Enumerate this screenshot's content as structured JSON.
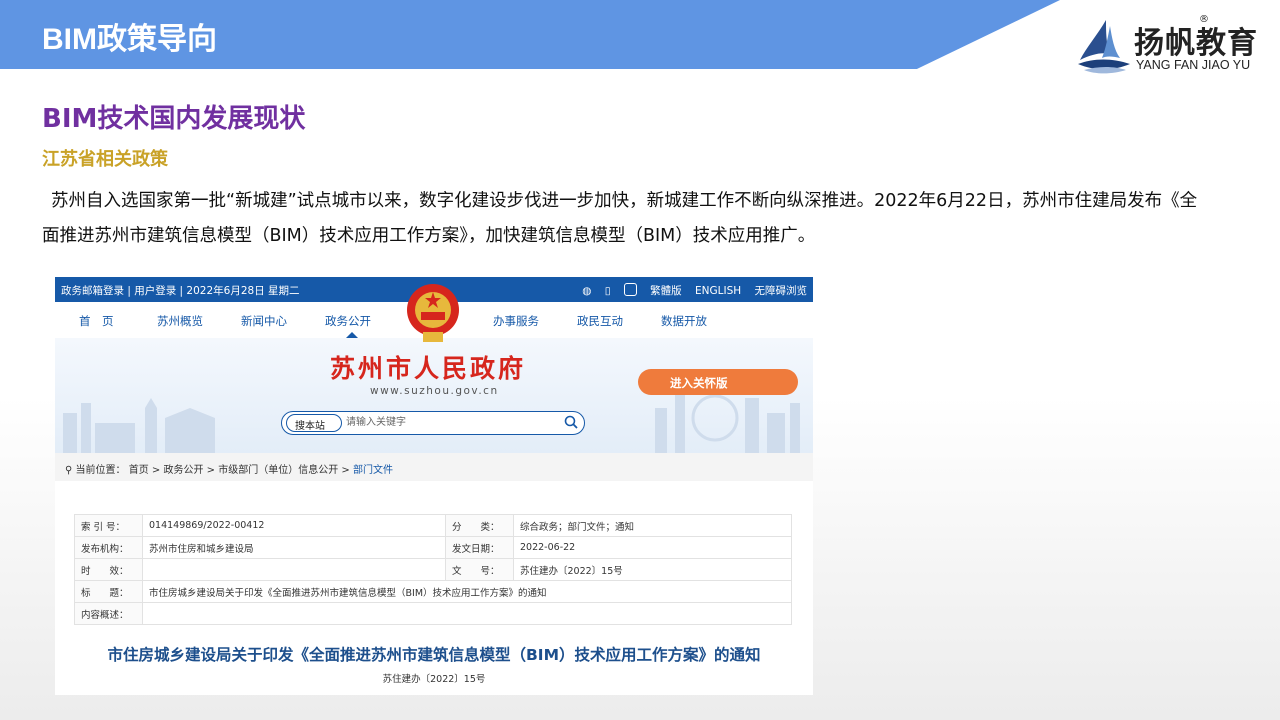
{
  "header": {
    "title": "BIM政策导向"
  },
  "logo": {
    "cn": "扬帆教育",
    "en": "YANG FAN JIAO YU",
    "reg": "®"
  },
  "section": {
    "title": "BIM技术国内发展现状",
    "subtitle": "江苏省相关政策"
  },
  "body_text": "苏州自入选国家第一批“新城建”试点城市以来，数字化建设步伐进一步加快，新城建工作不断向纵深推进。2022年6月22日，苏州市住建局发布《全面推进苏州市建筑信息模型（BIM）技术应用工作方案》，加快建筑信息模型（BIM）技术应用推广。",
  "colors": {
    "banner": "#5f95e3",
    "section_title": "#7030a0",
    "subtitle": "#c9a227",
    "site_blue": "#1659a8",
    "site_red": "#d6261d",
    "care_orange": "#ef7b3c"
  },
  "website": {
    "topbar": {
      "left": "政务邮箱登录 | 用户登录 | 2022年6月28日 星期二",
      "right_links": [
        "繁體版",
        "ENGLISH",
        "无障碍浏览"
      ],
      "icons": [
        "wechat-icon",
        "mobile-icon",
        "robot-icon"
      ]
    },
    "nav": [
      "首　页",
      "苏州概览",
      "新闻中心",
      "政务公开",
      "办事服务",
      "政民互动",
      "数据开放"
    ],
    "site_title": "苏州市人民政府",
    "site_url": "www.suzhou.gov.cn",
    "care_button": "进入关怀版",
    "search": {
      "scope": "搜本站",
      "placeholder": "请输入关键字"
    },
    "breadcrumb": {
      "label": "当前位置：",
      "items": [
        "首页",
        "政务公开",
        "市级部门（单位）信息公开",
        "部门文件"
      ],
      "sep": " > "
    },
    "doc_meta": [
      {
        "k1": "索 引 号：",
        "v1": "014149869/2022-00412",
        "k2": "分　　类：",
        "v2": "综合政务；部门文件；通知"
      },
      {
        "k1": "发布机构：",
        "v1": "苏州市住房和城乡建设局",
        "k2": "发文日期：",
        "v2": "2022-06-22"
      },
      {
        "k1": "时　　效：",
        "v1": "",
        "k2": "文　　号：",
        "v2": "苏住建办〔2022〕15号"
      }
    ],
    "doc_meta_title": {
      "k": "标　　题：",
      "v": "市住房城乡建设局关于印发《全面推进苏州市建筑信息模型（BIM）技术应用工作方案》的通知"
    },
    "doc_meta_summary": {
      "k": "内容概述：",
      "v": ""
    },
    "doc_title": "市住房城乡建设局关于印发《全面推进苏州市建筑信息模型（BIM）技术应用工作方案》的通知",
    "doc_no": "苏住建办〔2022〕15号"
  }
}
